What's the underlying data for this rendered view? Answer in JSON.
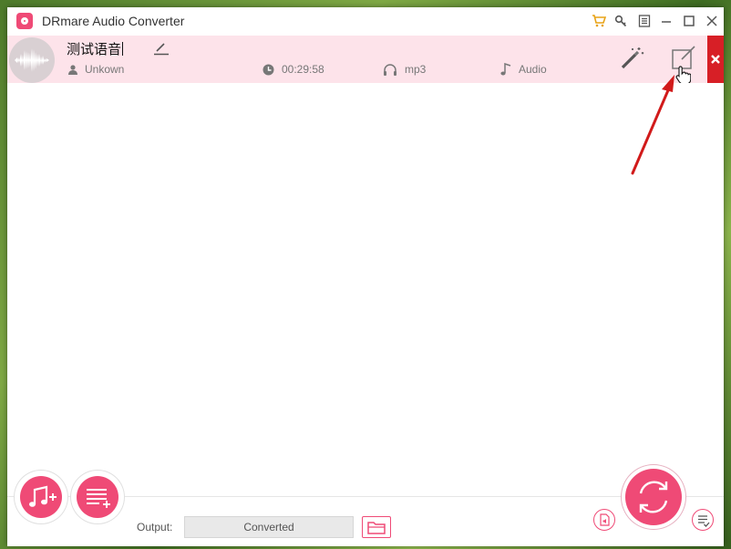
{
  "window": {
    "title": "DRmare Audio Converter"
  },
  "titlebar_icons": [
    "cart-icon",
    "key-icon",
    "menu-icon",
    "minimize-icon",
    "maximize-icon",
    "close-icon"
  ],
  "file": {
    "name": "测试语音",
    "artist": "Unkown",
    "duration": "00:29:58",
    "format": "mp3",
    "type": "Audio"
  },
  "output": {
    "label": "Output:",
    "value": "Converted"
  },
  "colors": {
    "accent": "#ef4a76",
    "row_bg": "#fde3ea",
    "delete_red": "#d71f26",
    "annotation_arrow": "#d11a1a"
  }
}
